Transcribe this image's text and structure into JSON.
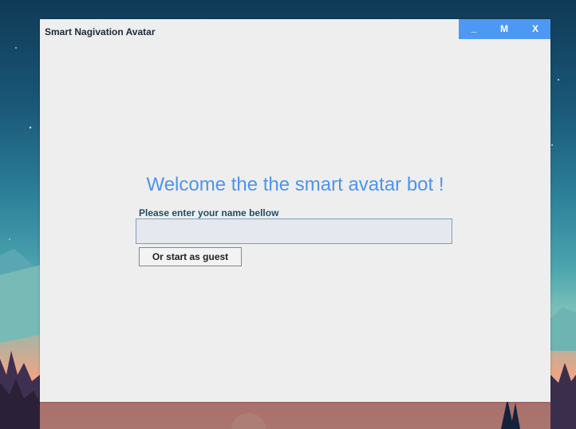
{
  "window": {
    "title": "Smart Nagivation Avatar",
    "controls": {
      "minimize": "_",
      "maximize": "M",
      "close": "X"
    }
  },
  "main": {
    "heading": "Welcome the the smart avatar bot !",
    "name_label": "Please enter your name bellow",
    "name_input_value": "",
    "guest_button_label": "Or start as guest"
  },
  "colors": {
    "controls_bg": "#4c98f4",
    "heading": "#4e94ea",
    "label": "#1f4e68",
    "window_bg": "#eeeeee"
  },
  "icons": {
    "wallpaper": "mountain-forest-sunset-wallpaper"
  }
}
